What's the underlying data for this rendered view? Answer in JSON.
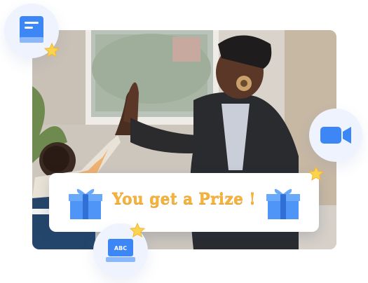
{
  "prize": {
    "message": "You get a Prize !"
  },
  "laptop_screen_text": "ABC",
  "colors": {
    "accent_blue": "#3d86f5",
    "prize_text": "#f3b33c",
    "star": "#fcd34d",
    "bubble_bg": "#eef3fd"
  },
  "icons": [
    "book-icon",
    "video-camera-icon",
    "laptop-abc-icon",
    "gift-icon",
    "star-icon"
  ]
}
